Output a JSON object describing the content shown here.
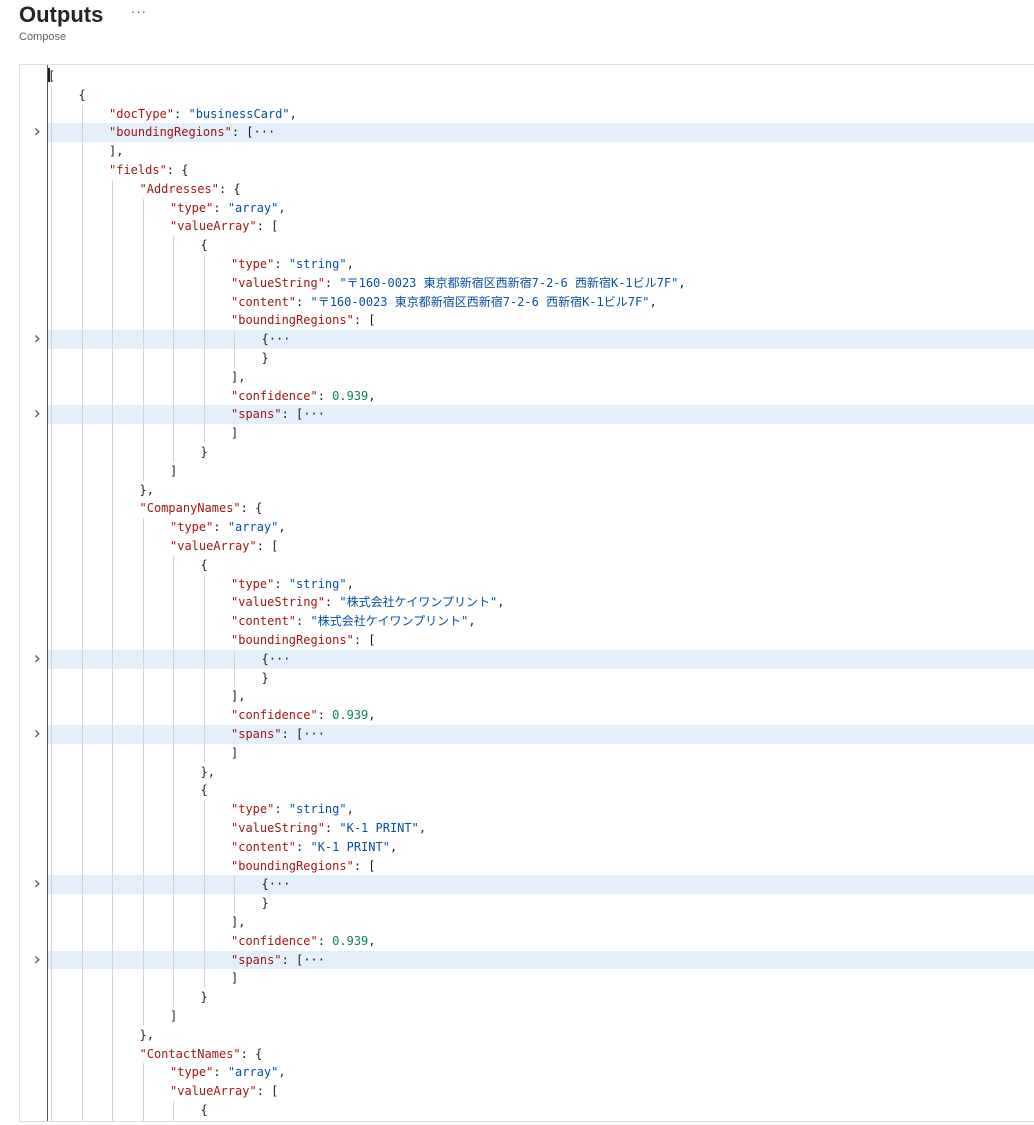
{
  "header": {
    "title": "Outputs",
    "more_label": "···",
    "subtitle": "Compose"
  },
  "lines": [
    {
      "indent": 0,
      "parts": [
        {
          "t": "[",
          "c": "p"
        }
      ]
    },
    {
      "indent": 1,
      "parts": [
        {
          "t": "{",
          "c": "p"
        }
      ]
    },
    {
      "indent": 2,
      "parts": [
        {
          "t": "\"docType\"",
          "c": "k"
        },
        {
          "t": ": ",
          "c": "p"
        },
        {
          "t": "\"businessCard\"",
          "c": "s"
        },
        {
          "t": ",",
          "c": "p"
        }
      ]
    },
    {
      "indent": 2,
      "fold": true,
      "parts": [
        {
          "t": "\"boundingRegions\"",
          "c": "k"
        },
        {
          "t": ": [",
          "c": "p"
        },
        {
          "t": "···",
          "c": "e"
        }
      ]
    },
    {
      "indent": 2,
      "parts": [
        {
          "t": "],",
          "c": "p"
        }
      ]
    },
    {
      "indent": 2,
      "parts": [
        {
          "t": "\"fields\"",
          "c": "k"
        },
        {
          "t": ": {",
          "c": "p"
        }
      ]
    },
    {
      "indent": 3,
      "parts": [
        {
          "t": "\"Addresses\"",
          "c": "k"
        },
        {
          "t": ": {",
          "c": "p"
        }
      ]
    },
    {
      "indent": 4,
      "parts": [
        {
          "t": "\"type\"",
          "c": "k"
        },
        {
          "t": ": ",
          "c": "p"
        },
        {
          "t": "\"array\"",
          "c": "s"
        },
        {
          "t": ",",
          "c": "p"
        }
      ]
    },
    {
      "indent": 4,
      "parts": [
        {
          "t": "\"valueArray\"",
          "c": "k"
        },
        {
          "t": ": [",
          "c": "p"
        }
      ]
    },
    {
      "indent": 5,
      "parts": [
        {
          "t": "{",
          "c": "p"
        }
      ]
    },
    {
      "indent": 6,
      "parts": [
        {
          "t": "\"type\"",
          "c": "k"
        },
        {
          "t": ": ",
          "c": "p"
        },
        {
          "t": "\"string\"",
          "c": "s"
        },
        {
          "t": ",",
          "c": "p"
        }
      ]
    },
    {
      "indent": 6,
      "parts": [
        {
          "t": "\"valueString\"",
          "c": "k"
        },
        {
          "t": ": ",
          "c": "p"
        },
        {
          "t": "\"〒160-0023 東京都新宿区西新宿7-2-6 西新宿K-1ビル7F\"",
          "c": "s"
        },
        {
          "t": ",",
          "c": "p"
        }
      ]
    },
    {
      "indent": 6,
      "parts": [
        {
          "t": "\"content\"",
          "c": "k"
        },
        {
          "t": ": ",
          "c": "p"
        },
        {
          "t": "\"〒160-0023 東京都新宿区西新宿7-2-6 西新宿K-1ビル7F\"",
          "c": "s"
        },
        {
          "t": ",",
          "c": "p"
        }
      ]
    },
    {
      "indent": 6,
      "parts": [
        {
          "t": "\"boundingRegions\"",
          "c": "k"
        },
        {
          "t": ": [",
          "c": "p"
        }
      ]
    },
    {
      "indent": 7,
      "fold": true,
      "parts": [
        {
          "t": "{",
          "c": "p"
        },
        {
          "t": "···",
          "c": "e"
        }
      ]
    },
    {
      "indent": 7,
      "parts": [
        {
          "t": "}",
          "c": "p"
        }
      ]
    },
    {
      "indent": 6,
      "parts": [
        {
          "t": "],",
          "c": "p"
        }
      ]
    },
    {
      "indent": 6,
      "parts": [
        {
          "t": "\"confidence\"",
          "c": "k"
        },
        {
          "t": ": ",
          "c": "p"
        },
        {
          "t": "0.939",
          "c": "n"
        },
        {
          "t": ",",
          "c": "p"
        }
      ]
    },
    {
      "indent": 6,
      "fold": true,
      "parts": [
        {
          "t": "\"spans\"",
          "c": "k"
        },
        {
          "t": ": [",
          "c": "p"
        },
        {
          "t": "···",
          "c": "e"
        }
      ]
    },
    {
      "indent": 6,
      "parts": [
        {
          "t": "]",
          "c": "p"
        }
      ]
    },
    {
      "indent": 5,
      "parts": [
        {
          "t": "}",
          "c": "p"
        }
      ]
    },
    {
      "indent": 4,
      "parts": [
        {
          "t": "]",
          "c": "p"
        }
      ]
    },
    {
      "indent": 3,
      "parts": [
        {
          "t": "},",
          "c": "p"
        }
      ]
    },
    {
      "indent": 3,
      "parts": [
        {
          "t": "\"CompanyNames\"",
          "c": "k"
        },
        {
          "t": ": {",
          "c": "p"
        }
      ]
    },
    {
      "indent": 4,
      "parts": [
        {
          "t": "\"type\"",
          "c": "k"
        },
        {
          "t": ": ",
          "c": "p"
        },
        {
          "t": "\"array\"",
          "c": "s"
        },
        {
          "t": ",",
          "c": "p"
        }
      ]
    },
    {
      "indent": 4,
      "parts": [
        {
          "t": "\"valueArray\"",
          "c": "k"
        },
        {
          "t": ": [",
          "c": "p"
        }
      ]
    },
    {
      "indent": 5,
      "parts": [
        {
          "t": "{",
          "c": "p"
        }
      ]
    },
    {
      "indent": 6,
      "parts": [
        {
          "t": "\"type\"",
          "c": "k"
        },
        {
          "t": ": ",
          "c": "p"
        },
        {
          "t": "\"string\"",
          "c": "s"
        },
        {
          "t": ",",
          "c": "p"
        }
      ]
    },
    {
      "indent": 6,
      "parts": [
        {
          "t": "\"valueString\"",
          "c": "k"
        },
        {
          "t": ": ",
          "c": "p"
        },
        {
          "t": "\"株式会社ケイワンプリント\"",
          "c": "s"
        },
        {
          "t": ",",
          "c": "p"
        }
      ]
    },
    {
      "indent": 6,
      "parts": [
        {
          "t": "\"content\"",
          "c": "k"
        },
        {
          "t": ": ",
          "c": "p"
        },
        {
          "t": "\"株式会社ケイワンプリント\"",
          "c": "s"
        },
        {
          "t": ",",
          "c": "p"
        }
      ]
    },
    {
      "indent": 6,
      "parts": [
        {
          "t": "\"boundingRegions\"",
          "c": "k"
        },
        {
          "t": ": [",
          "c": "p"
        }
      ]
    },
    {
      "indent": 7,
      "fold": true,
      "parts": [
        {
          "t": "{",
          "c": "p"
        },
        {
          "t": "···",
          "c": "e"
        }
      ]
    },
    {
      "indent": 7,
      "parts": [
        {
          "t": "}",
          "c": "p"
        }
      ]
    },
    {
      "indent": 6,
      "parts": [
        {
          "t": "],",
          "c": "p"
        }
      ]
    },
    {
      "indent": 6,
      "parts": [
        {
          "t": "\"confidence\"",
          "c": "k"
        },
        {
          "t": ": ",
          "c": "p"
        },
        {
          "t": "0.939",
          "c": "n"
        },
        {
          "t": ",",
          "c": "p"
        }
      ]
    },
    {
      "indent": 6,
      "fold": true,
      "parts": [
        {
          "t": "\"spans\"",
          "c": "k"
        },
        {
          "t": ": [",
          "c": "p"
        },
        {
          "t": "···",
          "c": "e"
        }
      ]
    },
    {
      "indent": 6,
      "parts": [
        {
          "t": "]",
          "c": "p"
        }
      ]
    },
    {
      "indent": 5,
      "parts": [
        {
          "t": "},",
          "c": "p"
        }
      ]
    },
    {
      "indent": 5,
      "parts": [
        {
          "t": "{",
          "c": "p"
        }
      ]
    },
    {
      "indent": 6,
      "parts": [
        {
          "t": "\"type\"",
          "c": "k"
        },
        {
          "t": ": ",
          "c": "p"
        },
        {
          "t": "\"string\"",
          "c": "s"
        },
        {
          "t": ",",
          "c": "p"
        }
      ]
    },
    {
      "indent": 6,
      "parts": [
        {
          "t": "\"valueString\"",
          "c": "k"
        },
        {
          "t": ": ",
          "c": "p"
        },
        {
          "t": "\"K-1 PRINT\"",
          "c": "s"
        },
        {
          "t": ",",
          "c": "p"
        }
      ]
    },
    {
      "indent": 6,
      "parts": [
        {
          "t": "\"content\"",
          "c": "k"
        },
        {
          "t": ": ",
          "c": "p"
        },
        {
          "t": "\"K-1 PRINT\"",
          "c": "s"
        },
        {
          "t": ",",
          "c": "p"
        }
      ]
    },
    {
      "indent": 6,
      "parts": [
        {
          "t": "\"boundingRegions\"",
          "c": "k"
        },
        {
          "t": ": [",
          "c": "p"
        }
      ]
    },
    {
      "indent": 7,
      "fold": true,
      "parts": [
        {
          "t": "{",
          "c": "p"
        },
        {
          "t": "···",
          "c": "e"
        }
      ]
    },
    {
      "indent": 7,
      "parts": [
        {
          "t": "}",
          "c": "p"
        }
      ]
    },
    {
      "indent": 6,
      "parts": [
        {
          "t": "],",
          "c": "p"
        }
      ]
    },
    {
      "indent": 6,
      "parts": [
        {
          "t": "\"confidence\"",
          "c": "k"
        },
        {
          "t": ": ",
          "c": "p"
        },
        {
          "t": "0.939",
          "c": "n"
        },
        {
          "t": ",",
          "c": "p"
        }
      ]
    },
    {
      "indent": 6,
      "fold": true,
      "parts": [
        {
          "t": "\"spans\"",
          "c": "k"
        },
        {
          "t": ": [",
          "c": "p"
        },
        {
          "t": "···",
          "c": "e"
        }
      ]
    },
    {
      "indent": 6,
      "parts": [
        {
          "t": "]",
          "c": "p"
        }
      ]
    },
    {
      "indent": 5,
      "parts": [
        {
          "t": "}",
          "c": "p"
        }
      ]
    },
    {
      "indent": 4,
      "parts": [
        {
          "t": "]",
          "c": "p"
        }
      ]
    },
    {
      "indent": 3,
      "parts": [
        {
          "t": "},",
          "c": "p"
        }
      ]
    },
    {
      "indent": 3,
      "parts": [
        {
          "t": "\"ContactNames\"",
          "c": "k"
        },
        {
          "t": ": {",
          "c": "p"
        }
      ]
    },
    {
      "indent": 4,
      "parts": [
        {
          "t": "\"type\"",
          "c": "k"
        },
        {
          "t": ": ",
          "c": "p"
        },
        {
          "t": "\"array\"",
          "c": "s"
        },
        {
          "t": ",",
          "c": "p"
        }
      ]
    },
    {
      "indent": 4,
      "parts": [
        {
          "t": "\"valueArray\"",
          "c": "k"
        },
        {
          "t": ": [",
          "c": "p"
        }
      ]
    },
    {
      "indent": 5,
      "parts": [
        {
          "t": "{",
          "c": "p"
        }
      ]
    }
  ]
}
